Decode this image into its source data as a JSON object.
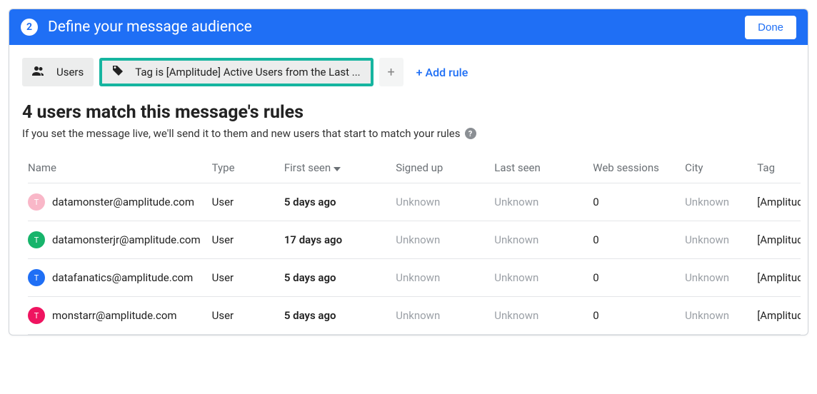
{
  "header": {
    "step": "2",
    "title": "Define your message audience",
    "done_label": "Done"
  },
  "filters": {
    "users_chip": "Users",
    "tag_chip": "Tag is [Amplitude] Active Users from the Last ...",
    "add_rule": "+ Add rule"
  },
  "summary": {
    "heading": "4 users match this message's rules",
    "subheading": "If you set the message live, we'll send it to them and new users that start to match your rules"
  },
  "columns": {
    "name": "Name",
    "type": "Type",
    "first_seen": "First seen",
    "signed_up": "Signed up",
    "last_seen": "Last seen",
    "web_sessions": "Web sessions",
    "city": "City",
    "tag": "Tag"
  },
  "rows": [
    {
      "avatar_letter": "T",
      "avatar_color": "#f9b7c8",
      "name": "datamonster@amplitude.com",
      "type": "User",
      "first_seen": "5 days ago",
      "signed_up": "Unknown",
      "last_seen": "Unknown",
      "web_sessions": "0",
      "city": "Unknown",
      "tag": "[Amplitude"
    },
    {
      "avatar_letter": "T",
      "avatar_color": "#17b46b",
      "name": "datamonsterjr@amplitude.com",
      "type": "User",
      "first_seen": "17 days ago",
      "signed_up": "Unknown",
      "last_seen": "Unknown",
      "web_sessions": "0",
      "city": "Unknown",
      "tag": "[Amplitude"
    },
    {
      "avatar_letter": "T",
      "avatar_color": "#1f6ff5",
      "name": "datafanatics@amplitude.com",
      "type": "User",
      "first_seen": "5 days ago",
      "signed_up": "Unknown",
      "last_seen": "Unknown",
      "web_sessions": "0",
      "city": "Unknown",
      "tag": "[Amplitude"
    },
    {
      "avatar_letter": "T",
      "avatar_color": "#ef1460",
      "name": "monstarr@amplitude.com",
      "type": "User",
      "first_seen": "5 days ago",
      "signed_up": "Unknown",
      "last_seen": "Unknown",
      "web_sessions": "0",
      "city": "Unknown",
      "tag": "[Amplitude"
    }
  ]
}
